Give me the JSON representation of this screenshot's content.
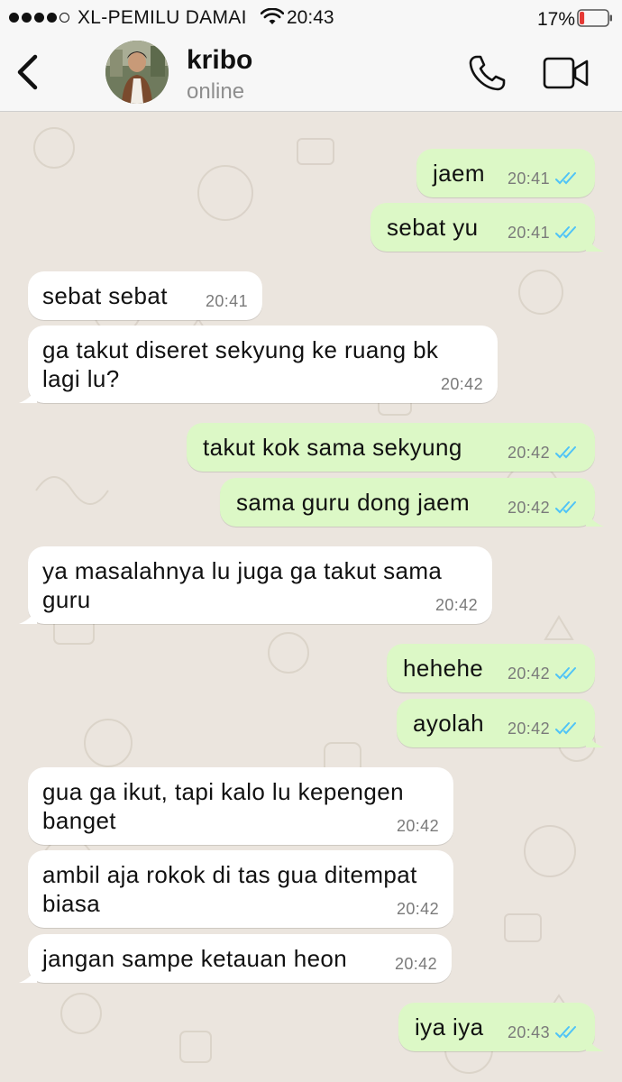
{
  "status_bar": {
    "carrier": "XL-PEMILU DAMAI",
    "time": "20:43",
    "battery": "17%",
    "signal_icon": "signal-dots-icon",
    "wifi_icon": "wifi-icon",
    "battery_icon": "battery-low-icon",
    "battery_level": 0.17
  },
  "header": {
    "back_icon": "chevron-left-icon",
    "contact_name": "kribo",
    "contact_status": "online",
    "call_icon": "phone-icon",
    "video_icon": "video-camera-icon"
  },
  "colors": {
    "outgoing": "#dcf8c6",
    "incoming": "#ffffff",
    "background": "#ebe5de",
    "read_ticks": "#4fc3f7"
  },
  "messages": [
    {
      "direction": "out",
      "text": "jaem",
      "time": "20:41",
      "read": true
    },
    {
      "direction": "out",
      "text": "sebat yu",
      "time": "20:41",
      "read": true
    },
    {
      "direction": "in",
      "text": "sebat sebat",
      "time": "20:41"
    },
    {
      "direction": "in",
      "text": "ga takut diseret sekyung ke ruang bk\nlagi lu?",
      "time": "20:42"
    },
    {
      "direction": "out",
      "text": "takut kok sama sekyung",
      "time": "20:42",
      "read": true
    },
    {
      "direction": "out",
      "text": "sama guru dong jaem",
      "time": "20:42",
      "read": true
    },
    {
      "direction": "in",
      "text": "ya masalahnya lu juga ga takut sama\nguru",
      "time": "20:42"
    },
    {
      "direction": "out",
      "text": "hehehe",
      "time": "20:42",
      "read": true
    },
    {
      "direction": "out",
      "text": "ayolah",
      "time": "20:42",
      "read": true
    },
    {
      "direction": "in",
      "text": "gua ga ikut, tapi kalo lu kepengen\nbanget",
      "time": "20:42"
    },
    {
      "direction": "in",
      "text": "ambil aja rokok di tas gua ditempat\nbiasa",
      "time": "20:42"
    },
    {
      "direction": "in",
      "text": "jangan sampe ketauan heon",
      "time": "20:42"
    },
    {
      "direction": "out",
      "text": "iya iya",
      "time": "20:43",
      "read": true
    }
  ]
}
